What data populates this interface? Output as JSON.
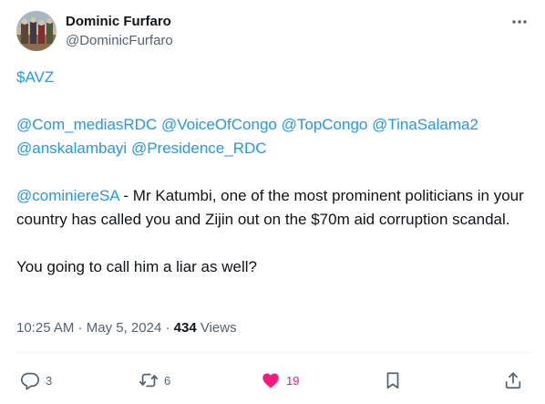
{
  "author": {
    "display_name": "Dominic Furfaro",
    "handle": "@DominicFurfaro"
  },
  "tweet": {
    "paragraphs": [
      [
        {
          "text": "$AVZ",
          "link": true
        }
      ],
      [],
      [
        {
          "text": "@Com_mediasRDC",
          "link": true
        },
        {
          "text": " ",
          "link": false
        },
        {
          "text": "@VoiceOfCongo",
          "link": true
        },
        {
          "text": " ",
          "link": false
        },
        {
          "text": "@TopCongo",
          "link": true
        },
        {
          "text": " ",
          "link": false
        },
        {
          "text": "@TinaSalama2",
          "link": true
        },
        {
          "text": " ",
          "link": false
        },
        {
          "text": "@anskalambayi",
          "link": true
        },
        {
          "text": " ",
          "link": false
        },
        {
          "text": "@Presidence_RDC",
          "link": true
        }
      ],
      [],
      [
        {
          "text": "@cominiereSA",
          "link": true
        },
        {
          "text": " - Mr Katumbi, one of the most prominent politicians in your country has called you and Zijin out on the $70m aid corruption scandal.",
          "link": false
        }
      ],
      [],
      [
        {
          "text": "You going to call him a liar as well?",
          "link": false
        }
      ]
    ]
  },
  "meta": {
    "time": "10:25 AM",
    "separator": " · ",
    "date": "May 5, 2024",
    "views_count": "434",
    "views_label": " Views"
  },
  "actions": {
    "reply_count": "3",
    "repost_count": "6",
    "like_count": "19"
  },
  "colors": {
    "link": "#1d9bf0",
    "like": "#f91880",
    "secondary_text": "#536471"
  },
  "icons": [
    "more-icon",
    "reply-icon",
    "repost-icon",
    "like-icon",
    "bookmark-icon",
    "share-icon"
  ]
}
